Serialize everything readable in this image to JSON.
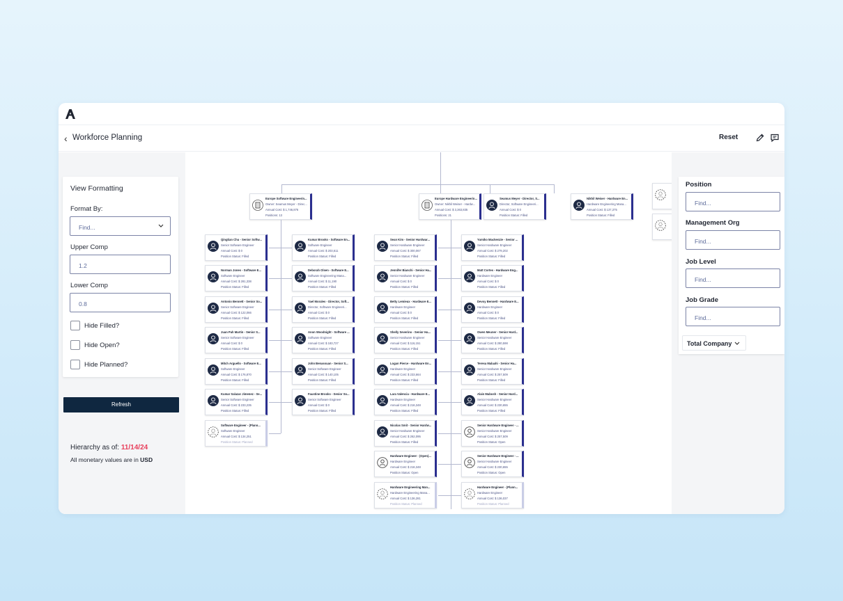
{
  "app": {
    "logo": "anthropic-a-logo"
  },
  "header": {
    "back_icon": "chevron-left-icon",
    "title": "Workforce Planning",
    "reset": "Reset",
    "edit_icon": "pencil-icon",
    "comment_icon": "comment-icon"
  },
  "view_formatting": {
    "title": "View Formatting",
    "format_by_label": "Format By:",
    "format_by_placeholder": "Find...",
    "upper_comp_label": "Upper Comp",
    "upper_comp_value": "1.2",
    "lower_comp_label": "Lower Comp",
    "lower_comp_value": "0.8",
    "hide_filled": "Hide Filled?",
    "hide_open": "Hide Open?",
    "hide_planned": "Hide Planned?"
  },
  "refresh": "Refresh",
  "hierarchy": {
    "label": "Hierarchy as of: ",
    "date": "11/14/24",
    "currency_text": "All monetary values are in ",
    "currency": "USD"
  },
  "filters": {
    "position_label": "Position",
    "management_org_label": "Management Org",
    "job_level_label": "Job Level",
    "job_grade_label": "Job Grade",
    "placeholder": "Find...",
    "total_company": "Total Company"
  },
  "colors": {
    "accent": "#2b2f8f",
    "refresh_bg": "#0f2740",
    "date": "#e83d5a"
  },
  "org": {
    "top": [
      {
        "name": "Europe Software Engineerin...",
        "l2": "Owner: Seamus Meyer - Direc...",
        "l3": "Annual Cost: $ 1,746,876",
        "l4": "Positions: 13",
        "icon": "building-icon"
      },
      {
        "name": "Europe Hardware Engineerin...",
        "l2": "Owner: Nikhil Weiser - Hardw...",
        "l3": "Annual Cost: $ 3,363,835",
        "l4": "Positions: 21",
        "icon": "building-icon"
      },
      {
        "name": "Seamus Meyer - Director, S...",
        "l2": "Director, Software Engineeri...",
        "l3": "Annual Cost: $ 0",
        "l4": "Position Status: Filled",
        "icon": "person-icon"
      },
      {
        "name": "Nikhil Weiser - Hardware En...",
        "l2": "Hardware Engineering Mana...",
        "l3": "Annual Cost: $ 137,375",
        "l4": "Position Status: Filled",
        "icon": "person-icon"
      }
    ],
    "col1": [
      {
        "name": "Qingtian Chu - Senior Softw...",
        "l2": "Senior Software Engineer",
        "l3": "Annual Cost: $ 0",
        "l4": "Position Status: Filled"
      },
      {
        "name": "Norman Jones - Software E...",
        "l2": "Software Engineer",
        "l3": "Annual Cost: $ 281,338",
        "l4": "Position Status: Filled"
      },
      {
        "name": "Antonio Bennett - Senior So...",
        "l2": "Senior Software Engineer",
        "l3": "Annual Cost: $ 122,066",
        "l4": "Position Status: Filled"
      },
      {
        "name": "Juan Pah Martin - Senior S...",
        "l2": "Senior Software Engineer",
        "l3": "Annual Cost: $ 0",
        "l4": "Position Status: Filled"
      },
      {
        "name": "Mitch Arguello - Software E...",
        "l2": "Software Engineer",
        "l3": "Annual Cost: $ 176,870",
        "l4": "Position Status: Filled"
      },
      {
        "name": "Kumar Salazar Jimenez - Se...",
        "l2": "Senior Software Engineer",
        "l3": "Annual Cost: $ 233,235",
        "l4": "Position Status: Filled"
      },
      {
        "name": "Software Engineer - (Plann...",
        "l2": "Software Engineer",
        "l3": "Annual Cost: $ 134,251",
        "l4": "Position Status: Planned",
        "planned": true
      }
    ],
    "col2": [
      {
        "name": "Kumar Brooks - Software En...",
        "l2": "Software Engineer",
        "l3": "Annual Cost: $ 203,611",
        "l4": "Position Status: Filled"
      },
      {
        "name": "Deborah Olsen - Software E...",
        "l2": "Software Engineering Mana...",
        "l3": "Annual Cost: $ 11,190",
        "l4": "Position Status: Filled"
      },
      {
        "name": "Yael Morales - Director, Soft...",
        "l2": "Director, Software Engineeri...",
        "l3": "Annual Cost: $ 0",
        "l4": "Position Status: Filled"
      },
      {
        "name": "Anon Woodnight - Software ...",
        "l2": "Software Engineer",
        "l3": "Annual Cost: $ 183,727",
        "l4": "Position Status: Filled"
      },
      {
        "name": "John Benassuan - Senior S...",
        "l2": "Senior Software Engineer",
        "l3": "Annual Cost: $ 140,105",
        "l4": "Position Status: Filled"
      },
      {
        "name": "Faustine Brooks - Senior So...",
        "l2": "Senior Software Engineer",
        "l3": "Annual Cost: $ 0",
        "l4": "Position Status: Filled"
      }
    ],
    "col3": [
      {
        "name": "Sean Kim - Senior Hardwar...",
        "l2": "Senior Hardware Engineer",
        "l3": "Annual Cost: $ 300,067",
        "l4": "Position Status: Filled"
      },
      {
        "name": "Jennifer Bianchi - Senior Ha...",
        "l2": "Senior Hardware Engineer",
        "l3": "Annual Cost: $ 0",
        "l4": "Position Status: Filled"
      },
      {
        "name": "Betty Lemieux - Hardware E...",
        "l2": "Hardware Engineer",
        "l3": "Annual Cost: $ 0",
        "l4": "Position Status: Filled"
      },
      {
        "name": "Shelly Severino - Senior Ha...",
        "l2": "Senior Hardware Engineer",
        "l3": "Annual Cost: $ 116,151",
        "l4": "Position Status: Filled"
      },
      {
        "name": "Logan Pierce - Hardware En...",
        "l2": "Hardware Engineer",
        "l3": "Annual Cost: $ 233,664",
        "l4": "Position Status: Filled"
      },
      {
        "name": "Lara Valencia - Hardware E...",
        "l2": "Hardware Engineer",
        "l3": "Annual Cost: $ 216,348",
        "l4": "Position Status: Filled"
      },
      {
        "name": "Nicolas Smit - Senior Hardw...",
        "l2": "Senior Hardware Engineer",
        "l3": "Annual Cost: $ 262,095",
        "l4": "Position Status: Filled"
      },
      {
        "name": "Hardware Engineer - (Open)...",
        "l2": "Hardware Engineer",
        "l3": "Annual Cost: $ 216,348",
        "l4": "Position Status: Open",
        "open": true
      },
      {
        "name": "Hardware Engineering Man...",
        "l2": "Hardware Engineering Mana...",
        "l3": "Annual Cost: $ 136,281",
        "l4": "Position Status: Planned",
        "planned": true
      }
    ],
    "col4": [
      {
        "name": "Yumiko Mackenzie - Senior ...",
        "l2": "Senior Hardware Engineer",
        "l3": "Annual Cost: $ 279,202",
        "l4": "Position Status: Filled"
      },
      {
        "name": "Matt Cortes - Hardware Eng...",
        "l2": "Hardware Engineer",
        "l3": "Annual Cost: $ 0",
        "l4": "Position Status: Filled"
      },
      {
        "name": "Devoy Bennett - Hardware E...",
        "l2": "Hardware Engineer",
        "l3": "Annual Cost: $ 0",
        "l4": "Position Status: Filled"
      },
      {
        "name": "Owen Meuner - Senior Hard...",
        "l2": "Senior Hardware Engineer",
        "l3": "Annual Cost: $ 280,598",
        "l4": "Position Status: Filled"
      },
      {
        "name": "Teresa Malaahi - Senior Ha...",
        "l2": "Senior Hardware Engineer",
        "l3": "Annual Cost: $ 257,509",
        "l4": "Position Status: Filled"
      },
      {
        "name": "Alain Mabosh - Senior Hard...",
        "l2": "Senior Hardware Engineer",
        "l3": "Annual Cost: $ 230,655",
        "l4": "Position Status: Filled"
      },
      {
        "name": "Senior Hardware Engineer - ...",
        "l2": "Senior Hardware Engineer",
        "l3": "Annual Cost: $ 257,509",
        "l4": "Position Status: Open",
        "open": true
      },
      {
        "name": "Senior Hardware Engineer - ...",
        "l2": "Senior Hardware Engineer",
        "l3": "Annual Cost: $ 230,655",
        "l4": "Position Status: Open",
        "open": true
      },
      {
        "name": "Hardware Engineer - (Plann...",
        "l2": "Hardware Engineer",
        "l3": "Annual Cost: $ 136,037",
        "l4": "Position Status: Planned",
        "planned": true
      }
    ]
  }
}
